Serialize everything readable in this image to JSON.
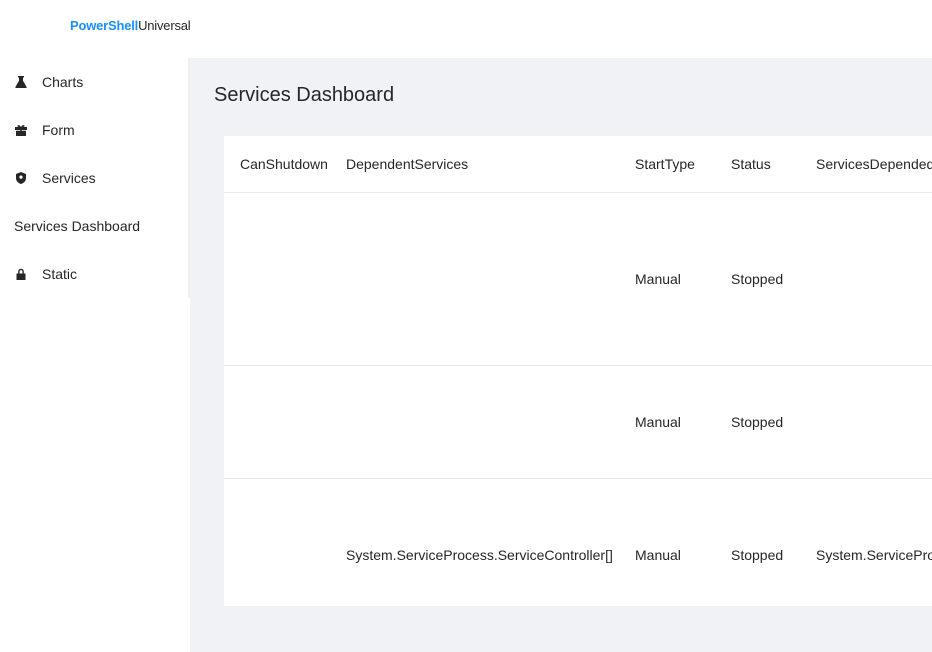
{
  "app": {
    "logo_brand": "PowerShell",
    "logo_rest": "Universal"
  },
  "sidebar": {
    "items": [
      {
        "label": "Charts",
        "icon": "flask-icon"
      },
      {
        "label": "Form",
        "icon": "gift-icon"
      },
      {
        "label": "Services",
        "icon": "shield-icon"
      },
      {
        "label": "Services Dashboard",
        "icon": ""
      },
      {
        "label": "Static",
        "icon": "lock-icon"
      }
    ]
  },
  "main": {
    "title": "Services Dashboard",
    "table": {
      "columns": [
        "CanShutdown",
        "DependentServices",
        "StartType",
        "Status",
        "ServicesDepended"
      ],
      "rows": [
        {
          "can_shutdown": "",
          "dependent_services": "",
          "start_type": "Manual",
          "status": "Stopped",
          "services_depended_on": ""
        },
        {
          "can_shutdown": "",
          "dependent_services": "",
          "start_type": "Manual",
          "status": "Stopped",
          "services_depended_on": ""
        },
        {
          "can_shutdown": "",
          "dependent_services": "System.ServiceProcess.ServiceController[]",
          "start_type": "Manual",
          "status": "Stopped",
          "services_depended_on": "System.ServicePro"
        }
      ]
    }
  },
  "colors": {
    "brand": "#1890ff",
    "content_bg": "#f0f2f5",
    "text": "#262626"
  }
}
